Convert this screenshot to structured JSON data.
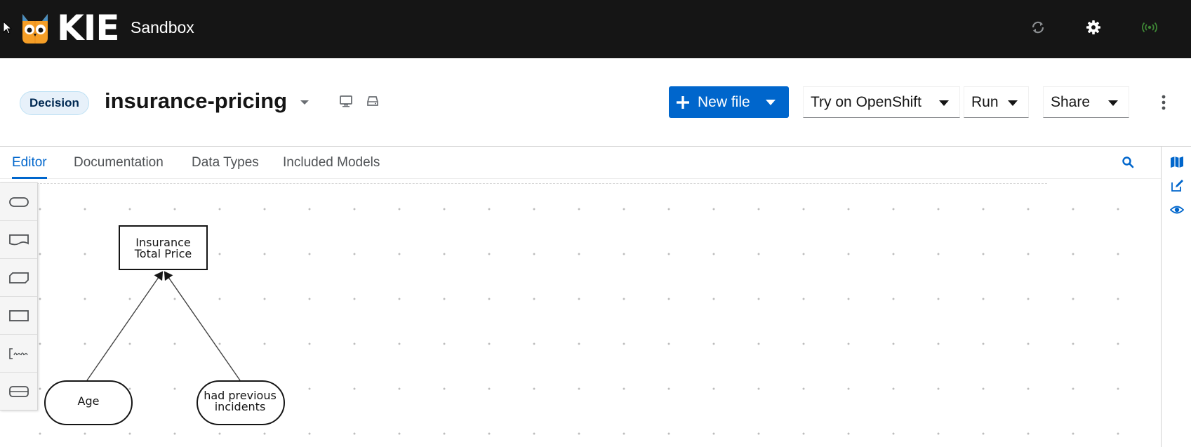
{
  "masthead": {
    "brand_name": "KIE",
    "product_name": "Sandbox",
    "icons": [
      "sync-icon",
      "gear-icon",
      "connection-status-icon"
    ],
    "status_color": "#3e8635"
  },
  "header": {
    "file_type_label": "Decision",
    "file_name": "insurance-pricing",
    "new_file_label": "New file",
    "try_openshift_label": "Try on OpenShift",
    "run_label": "Run",
    "share_label": "Share"
  },
  "tabs": [
    {
      "label": "Editor",
      "active": true
    },
    {
      "label": "Documentation",
      "active": false
    },
    {
      "label": "Data Types",
      "active": false
    },
    {
      "label": "Included Models",
      "active": false
    }
  ],
  "palette": {
    "items": [
      "decision-node-tool",
      "input-data-tool",
      "knowledge-source-tool",
      "bkm-tool",
      "text-annotation-tool",
      "decision-service-tool"
    ]
  },
  "diagram": {
    "nodes": [
      {
        "id": "insurance-total-price",
        "type": "decision",
        "label_line1": "Insurance",
        "label_line2": "Total Price"
      },
      {
        "id": "age",
        "type": "input-data",
        "label": "Age"
      },
      {
        "id": "had-previous-incidents",
        "type": "input-data",
        "label_line1": "had previous",
        "label_line2": "incidents"
      }
    ]
  },
  "accent_color": "#0066cc"
}
